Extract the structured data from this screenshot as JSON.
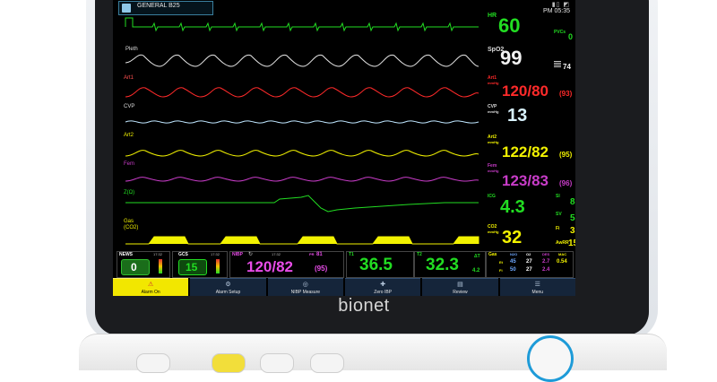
{
  "brand": "bionet",
  "topbar": {
    "patient_name": "GENERAL B25",
    "time": "PM 05:35"
  },
  "waves": {
    "pleth": "Pleth",
    "art1": "Art1",
    "cvp": "CVP",
    "art2": "Art2",
    "fem": "Fem",
    "zi_ol": "Z(Ω)",
    "gas": "Gas",
    "gas_sub": "(CO2)"
  },
  "params": {
    "hr": {
      "label": "HR",
      "value": "60",
      "color": "#22dd22"
    },
    "pvcs": {
      "label": "PVCs",
      "value": "0"
    },
    "spo2": {
      "label": "SpO2",
      "value": "99",
      "color": "#f2f2f2"
    },
    "pi_value": "74",
    "art1": {
      "label": "Art1",
      "unit": "mmHg",
      "value": "120/80",
      "mean": "(93)",
      "color": "#ff2a2a"
    },
    "cvp": {
      "label": "CVP",
      "unit": "mmHg",
      "value": "13",
      "color": "#d8f2ff"
    },
    "art2": {
      "label": "Art2",
      "unit": "mmHg",
      "value": "122/82",
      "mean": "(95)",
      "color": "#f2f200"
    },
    "fem": {
      "label": "Fem",
      "unit": "mmHg",
      "value": "123/83",
      "mean": "(96)",
      "color": "#c83cc8"
    },
    "ico": {
      "label": "ICG",
      "value": "4.3",
      "color": "#22dd22"
    },
    "si": {
      "label": "SI",
      "value": "81"
    },
    "sv": {
      "label": "SV",
      "value": "55"
    },
    "co2": {
      "label": "CO2",
      "unit": "mmHg",
      "value": "32",
      "color": "#f2f200"
    },
    "fi": {
      "label": "Fi",
      "value": "3"
    },
    "awrr": {
      "label": "AwRR",
      "value": "15"
    }
  },
  "bottom": {
    "news": {
      "label": "NEWS",
      "time": "17:32",
      "value": "0"
    },
    "gcs": {
      "label": "GCS",
      "time": "17:32",
      "value": "15"
    },
    "nibp": {
      "label": "NIBP",
      "time": "17:32",
      "value": "120/82",
      "pr_label": "PR",
      "pr_value": "81",
      "mean": "(95)"
    },
    "t1": {
      "label": "T1",
      "value": "36.5"
    },
    "t2": {
      "label": "T2",
      "value": "32.3",
      "dt_label": "ΔT",
      "dt_value": "4.2"
    },
    "gas": {
      "label": "Gas",
      "headers": [
        "N2O",
        "O2",
        "DES",
        "MAC"
      ],
      "et_label": "Et",
      "fi_label": "Fi",
      "et_values": [
        "45",
        "27",
        "2.7",
        "0.54"
      ],
      "fi_values": [
        "50",
        "27",
        "2.4",
        ""
      ]
    }
  },
  "menu": {
    "alarm_on": "Alarm On",
    "alarm_setup": "Alarm Setup",
    "nibp_measure": "NIBP Measure",
    "zero_ibp": "Zero IBP",
    "review": "Review",
    "menu": "Menu"
  }
}
